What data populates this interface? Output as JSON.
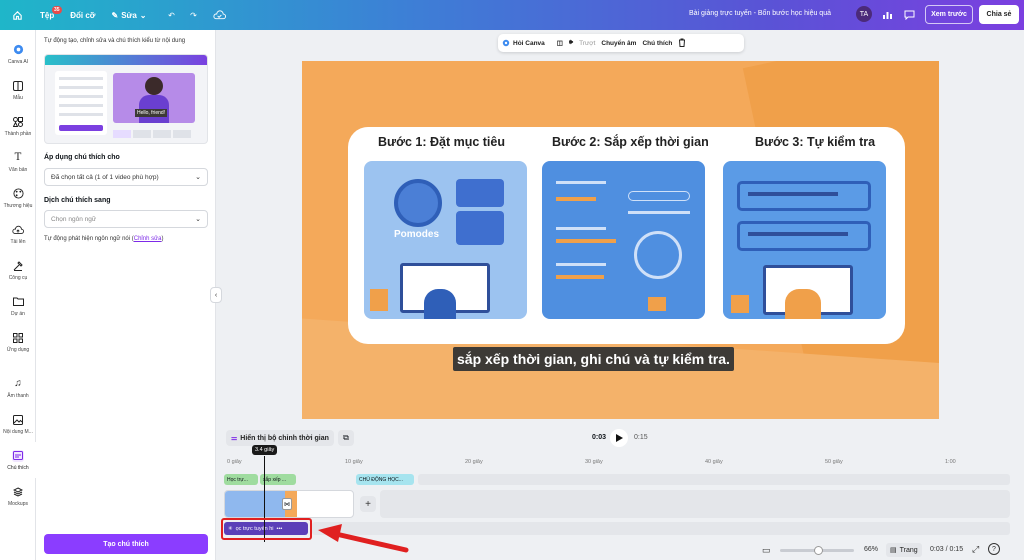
{
  "topbar": {
    "file_label": "Tệp",
    "file_badge": "35",
    "resize_label": "Đổi cỡ",
    "edit_label": "Sửa",
    "doc_title": "Bài giảng trực tuyến - Bốn bước học hiệu quả",
    "avatar_initials": "TA",
    "preview_label": "Xem trước",
    "share_label": "Chia sẻ"
  },
  "rail": {
    "items": [
      {
        "label": "Canva AI",
        "icon": "canva-ai-icon"
      },
      {
        "label": "Mẫu",
        "icon": "template-icon"
      },
      {
        "label": "Thành phần",
        "icon": "elements-icon"
      },
      {
        "label": "Văn bản",
        "icon": "text-icon"
      },
      {
        "label": "Thương hiệu",
        "icon": "brand-icon"
      },
      {
        "label": "Tải lên",
        "icon": "upload-icon"
      },
      {
        "label": "Công cụ",
        "icon": "tools-icon"
      },
      {
        "label": "Dự án",
        "icon": "folder-icon"
      },
      {
        "label": "Ứng dụng",
        "icon": "apps-icon"
      },
      {
        "label": "Âm thanh",
        "icon": "music-icon"
      },
      {
        "label": "Nội dung M...",
        "icon": "media-icon"
      },
      {
        "label": "Chú thích",
        "icon": "captions-icon"
      },
      {
        "label": "Mockups",
        "icon": "mockups-icon"
      }
    ]
  },
  "panel": {
    "intro": "Tự động tạo, chỉnh sửa và chú thích kiểu từ nội dung",
    "preview_caption": "Hello, friend!",
    "apply_heading": "Áp dụng chú thích cho",
    "apply_value": "Đã chọn tất cả (1 of 1 video phù hợp)",
    "translate_heading": "Dịch chú thích sang",
    "translate_placeholder": "Chọn ngôn ngữ",
    "auto_detect_text": "Tự động phát hiện ngôn ngữ nói (",
    "auto_detect_link": "Chỉnh sửa",
    "auto_detect_end": ")",
    "create_button": "Tạo chú thích"
  },
  "float_toolbar": {
    "ask_canva": "Hỏi Canva",
    "transition": "Trượt",
    "animate": "Chuyển âm",
    "captions": "Chú thích"
  },
  "slide": {
    "step1_title": "Bước 1: Đặt mục tiêu",
    "step2_title": "Bước 2: Sắp xếp thời gian",
    "step3_title": "Bước 3: Tự kiểm tra",
    "pomodoro_label": "Pomodes",
    "subtitle": "sắp xếp thời gian, ghi chú và tự kiểm tra."
  },
  "timeline": {
    "show_timing": "Hiển thị bộ chỉnh thời gian",
    "current_time": "0:03",
    "total_time": "0:15",
    "playhead_tooltip": "3.4 giây",
    "ticks": [
      "0 giây",
      "10 giây",
      "20 giây",
      "30 giây",
      "40 giây",
      "50 giây",
      "1:00"
    ],
    "caption_clips": [
      "Học trự...",
      "sắp xếp ...",
      "CHỦ ĐỘNG HỌC..."
    ],
    "audio_track_label": "ọc trực tuyến hi"
  },
  "bottombar": {
    "zoom": "66%",
    "pages_label": "Trang",
    "time_display": "0:03 / 0:15"
  },
  "colors": {
    "accent": "#8b3dff",
    "canvas_bg": "#f4a95a",
    "highlight": "#e02020"
  }
}
